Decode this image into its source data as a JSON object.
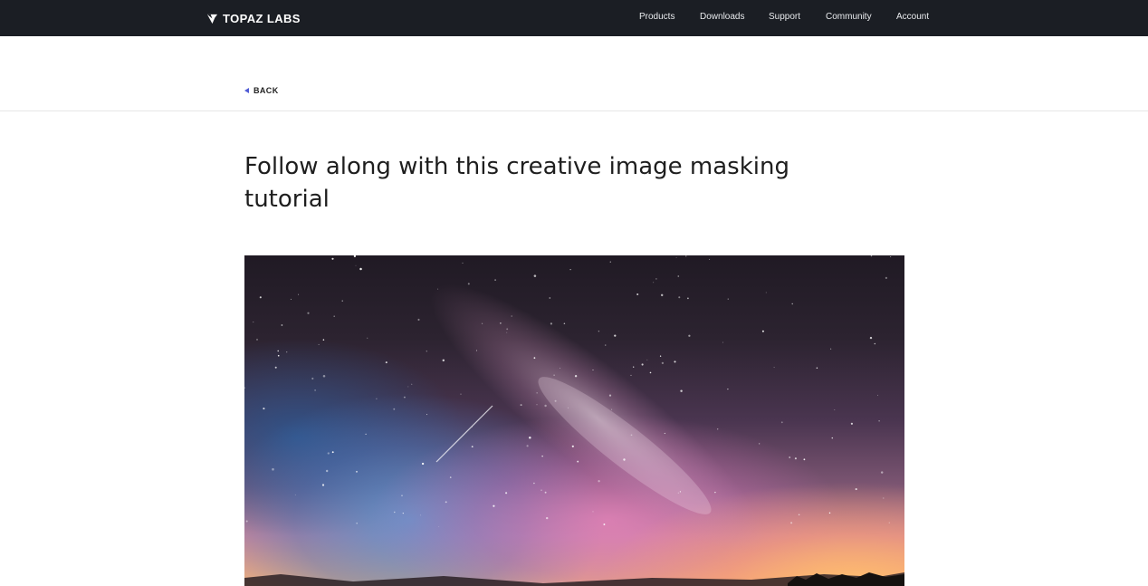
{
  "brand": {
    "name": "TOPAZ LABS",
    "icon": "topaz-logo-icon"
  },
  "nav": {
    "items": [
      {
        "label": "Products"
      },
      {
        "label": "Downloads"
      },
      {
        "label": "Support"
      },
      {
        "label": "Community"
      },
      {
        "label": "Account"
      }
    ]
  },
  "back": {
    "label": "BACK",
    "icon": "caret-left-icon"
  },
  "article": {
    "title": "Follow along with this creative image masking tutorial",
    "hero": {
      "description_icon": "night-sky-photo"
    }
  },
  "colors": {
    "topbar": "#1b1e24",
    "accent": "#4f5bd5",
    "text": "#1e1e1e"
  }
}
